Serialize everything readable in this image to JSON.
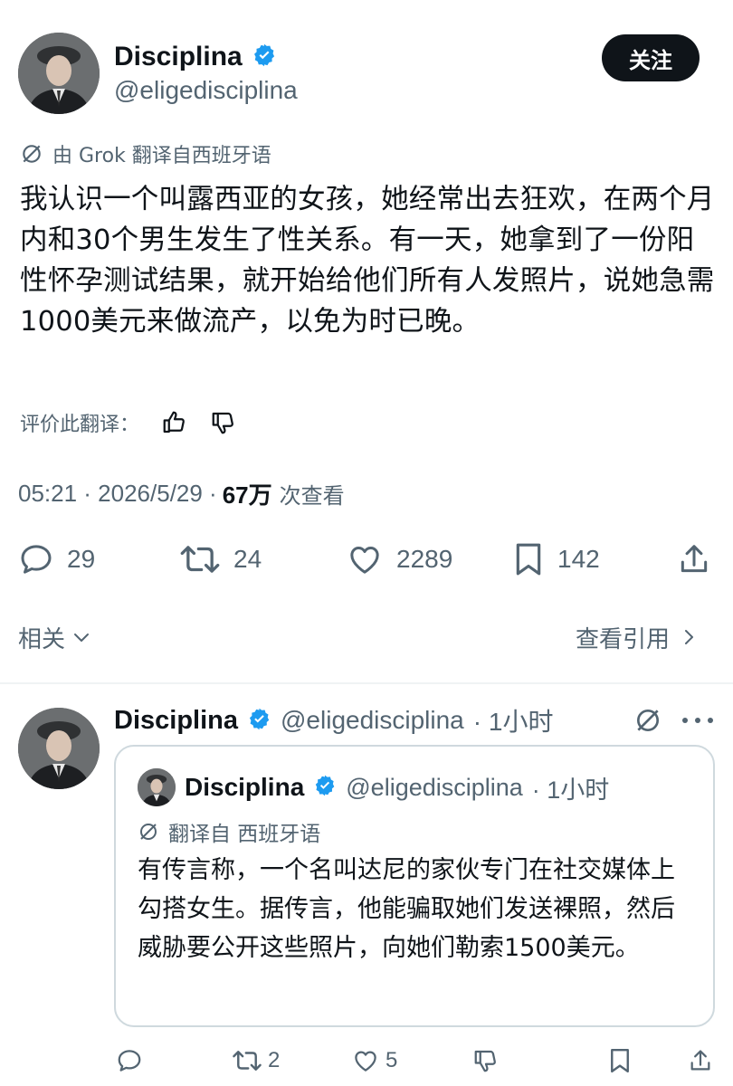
{
  "main_tweet": {
    "author_name": "Disciplina",
    "author_handle": "@eligedisciplina",
    "follow_label": "关注",
    "translation_note": "由 Grok 翻译自西班牙语",
    "text": "我认识一个叫露西亚的女孩，她经常出去狂欢，在两个月内和30个男生发生了性关系。有一天，她拿到了一份阳性怀孕测试结果，就开始给他们所有人发照片，说她急需1000美元来做流产，以免为时已晚。",
    "rate_label": "评价此翻译：",
    "time": "05:21 · 2026/5/29 ·",
    "views": "67万",
    "views_label": "次查看",
    "actions": {
      "replies": "29",
      "retweets": "24",
      "likes": "2289",
      "bookmarks": "142"
    },
    "related_label": "相关",
    "view_quotes_label": "查看引用"
  },
  "reply": {
    "author_name": "Disciplina",
    "author_handle": "@eligedisciplina",
    "time": "· 1小时",
    "quoted": {
      "author_name": "Disciplina",
      "author_handle": "@eligedisciplina",
      "time": "· 1小时",
      "translation_note": "翻译自 西班牙语",
      "text": "有传言称，一个名叫达尼的家伙专门在社交媒体上勾搭女生。据传言，他能骗取她们发送裸照，然后威胁要公开这些照片，向她们勒索1500美元。"
    },
    "actions": {
      "retweets": "2",
      "likes": "5"
    }
  },
  "colors": {
    "text_primary": "#0f1419",
    "text_secondary": "#536471",
    "verified_blue": "#1d9bf0",
    "divider": "#eff3f4",
    "card_border": "#cfd9de"
  }
}
